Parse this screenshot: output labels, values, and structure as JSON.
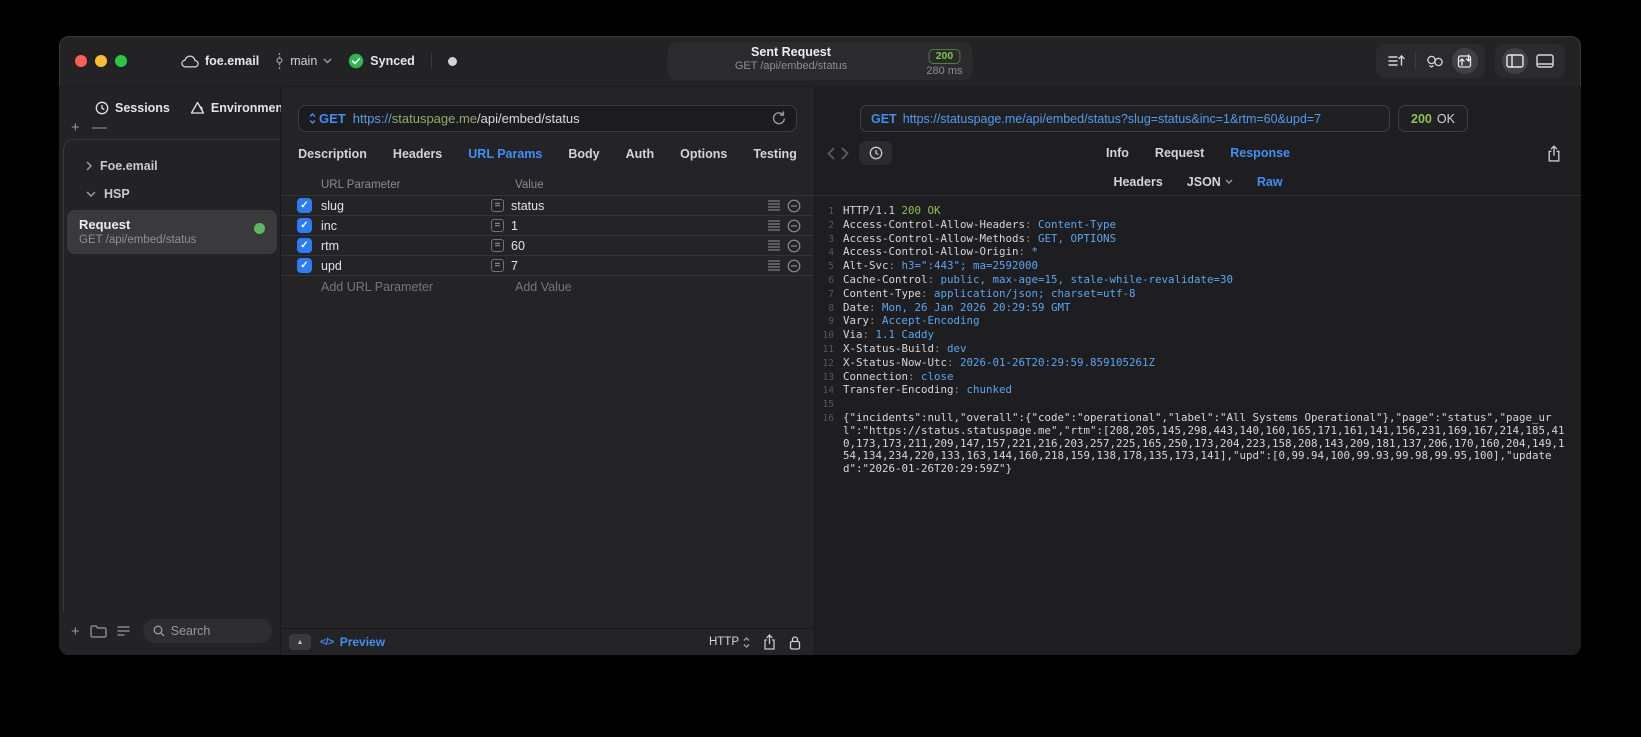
{
  "colors": {
    "accent_blue": "#3f8ff6",
    "code_value_blue": "#58a6f2",
    "status_green": "#8ec04f",
    "checkbox_blue": "#2e7bf6",
    "request_dot_green": "#5cb85c",
    "url_host_green": "#93ab66"
  },
  "icons": [
    "cloud-icon",
    "git-branch-icon",
    "chevron-down-icon",
    "synced-check-icon",
    "notification-dot",
    "request-order-icon",
    "sync-branches-icon",
    "send-receive-icon",
    "sidebar-left-icon",
    "panel-bottom-icon",
    "history-icon",
    "environments-icon",
    "chevron-right-icon",
    "folder-icon",
    "list-view-icon",
    "search-icon",
    "refresh-icon",
    "equals-icon",
    "reorder-handle-icon",
    "remove-circle-icon",
    "drawer-toggle-icon",
    "code-icon",
    "http-stepper-icon",
    "share-icon",
    "lock-icon",
    "back-icon",
    "forward-icon"
  ],
  "titlebar": {
    "project": "foe.email",
    "branch": "main",
    "sync_label": "Synced",
    "request_summary": {
      "title": "Sent Request",
      "method_path": "GET /api/embed/status",
      "status_code": "200",
      "duration": "280 ms"
    }
  },
  "sidebar": {
    "tabs": [
      {
        "label": "Sessions"
      },
      {
        "label": "Environments"
      }
    ],
    "plus": "+",
    "minus": "—",
    "groups": [
      {
        "label": "Foe.email",
        "state": "collapsed"
      },
      {
        "label": "HSP",
        "state": "expanded"
      }
    ],
    "selected_request": {
      "name": "Request",
      "subtitle": "GET /api/embed/status"
    },
    "search_placeholder": "Search"
  },
  "editor": {
    "method": "GET",
    "url": {
      "scheme": "https://",
      "host": "statuspage.me",
      "path": "/api/embed/status"
    },
    "tabs": [
      {
        "label": "Description"
      },
      {
        "label": "Headers"
      },
      {
        "label": "URL Params"
      },
      {
        "label": "Body"
      },
      {
        "label": "Auth"
      },
      {
        "label": "Options"
      },
      {
        "label": "Testing"
      }
    ],
    "active_tab": "URL Params",
    "table": {
      "headers": [
        "URL Parameter",
        "Value"
      ],
      "rows": [
        {
          "checked": true,
          "name": "slug",
          "value": "status"
        },
        {
          "checked": true,
          "name": "inc",
          "value": "1"
        },
        {
          "checked": true,
          "name": "rtm",
          "value": "60"
        },
        {
          "checked": true,
          "name": "upd",
          "value": "7"
        }
      ],
      "add_row": {
        "name_placeholder": "Add URL Parameter",
        "value_placeholder": "Add Value"
      }
    },
    "footer": {
      "code_glyph": "</>",
      "preview": "Preview",
      "http": "HTTP"
    }
  },
  "viewer": {
    "request_line": {
      "method": "GET",
      "url": "https://statuspage.me/api/embed/status?slug=status&inc=1&rtm=60&upd=7"
    },
    "status": {
      "code": "200",
      "text": "OK"
    },
    "tabs": [
      {
        "label": "Info"
      },
      {
        "label": "Request"
      },
      {
        "label": "Response"
      }
    ],
    "active_tab": "Response",
    "subtabs": [
      {
        "label": "Headers"
      },
      {
        "label": "JSON",
        "dropdown": true
      },
      {
        "label": "Raw"
      }
    ],
    "active_subtab": "Raw",
    "response_lines": [
      {
        "n": "1",
        "seg": [
          [
            "p",
            "HTTP/1.1 "
          ],
          [
            "g",
            "200 OK"
          ]
        ]
      },
      {
        "n": "2",
        "seg": [
          [
            "p",
            "Access-Control-Allow-Headers"
          ],
          [
            "c",
            ": "
          ],
          [
            "v",
            "Content-Type"
          ]
        ]
      },
      {
        "n": "3",
        "seg": [
          [
            "p",
            "Access-Control-Allow-Methods"
          ],
          [
            "c",
            ": "
          ],
          [
            "v",
            "GET, OPTIONS"
          ]
        ]
      },
      {
        "n": "4",
        "seg": [
          [
            "p",
            "Access-Control-Allow-Origin"
          ],
          [
            "c",
            ": "
          ],
          [
            "v",
            "*"
          ]
        ]
      },
      {
        "n": "5",
        "seg": [
          [
            "p",
            "Alt-Svc"
          ],
          [
            "c",
            ": "
          ],
          [
            "v",
            "h3=\":443\"; ma=2592000"
          ]
        ]
      },
      {
        "n": "6",
        "seg": [
          [
            "p",
            "Cache-Control"
          ],
          [
            "c",
            ": "
          ],
          [
            "v",
            "public, max-age=15, stale-while-revalidate=30"
          ]
        ]
      },
      {
        "n": "7",
        "seg": [
          [
            "p",
            "Content-Type"
          ],
          [
            "c",
            ": "
          ],
          [
            "v",
            "application/json; charset=utf-8"
          ]
        ]
      },
      {
        "n": "8",
        "seg": [
          [
            "p",
            "Date"
          ],
          [
            "c",
            ": "
          ],
          [
            "v",
            "Mon, 26 Jan 2026 20:29:59 GMT"
          ]
        ]
      },
      {
        "n": "9",
        "seg": [
          [
            "p",
            "Vary"
          ],
          [
            "c",
            ": "
          ],
          [
            "v",
            "Accept-Encoding"
          ]
        ]
      },
      {
        "n": "10",
        "seg": [
          [
            "p",
            "Via"
          ],
          [
            "c",
            ": "
          ],
          [
            "v",
            "1.1 Caddy"
          ]
        ]
      },
      {
        "n": "11",
        "seg": [
          [
            "p",
            "X-Status-Build"
          ],
          [
            "c",
            ": "
          ],
          [
            "v",
            "dev"
          ]
        ]
      },
      {
        "n": "12",
        "seg": [
          [
            "p",
            "X-Status-Now-Utc"
          ],
          [
            "c",
            ": "
          ],
          [
            "v",
            "2026-01-26T20:29:59.859105261Z"
          ]
        ]
      },
      {
        "n": "13",
        "seg": [
          [
            "p",
            "Connection"
          ],
          [
            "c",
            ": "
          ],
          [
            "v",
            "close"
          ]
        ]
      },
      {
        "n": "14",
        "seg": [
          [
            "p",
            "Transfer-Encoding"
          ],
          [
            "c",
            ": "
          ],
          [
            "v",
            "chunked"
          ]
        ]
      },
      {
        "n": "15",
        "seg": []
      },
      {
        "n": "16",
        "seg": [
          [
            "p",
            "{\"incidents\":null,\"overall\":{\"code\":\"operational\",\"label\":\"All Systems Operational\"},\"page\":\"status\",\"page_url\":\"https://status.statuspage.me\",\"rtm\":[208,205,145,298,443,140,160,165,171,161,141,156,231,169,167,214,185,410,173,173,211,209,147,157,221,216,203,257,225,165,250,173,204,223,158,208,143,209,181,137,206,170,160,204,149,154,134,234,220,133,163,144,160,218,159,138,178,135,173,141],\"upd\":[0,99.94,100,99.93,99.98,99.95,100],\"updated\":\"2026-01-26T20:29:59Z\"}"
          ]
        ]
      }
    ]
  }
}
